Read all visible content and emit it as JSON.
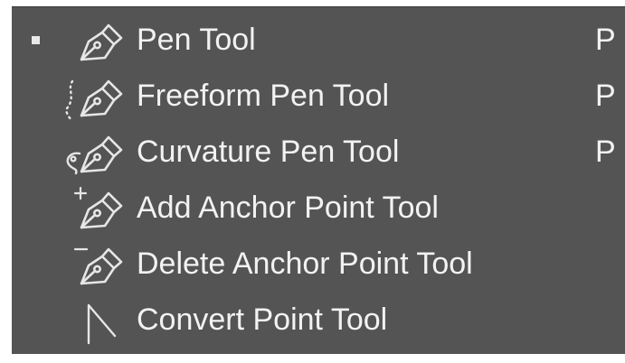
{
  "menu": {
    "items": [
      {
        "label": "Pen Tool",
        "shortcut": "P",
        "icon": "pen-icon",
        "selected": true
      },
      {
        "label": "Freeform Pen Tool",
        "shortcut": "P",
        "icon": "freeform-pen-icon",
        "selected": false
      },
      {
        "label": "Curvature Pen Tool",
        "shortcut": "P",
        "icon": "curvature-pen-icon",
        "selected": false
      },
      {
        "label": "Add Anchor Point Tool",
        "shortcut": "",
        "icon": "add-anchor-point-icon",
        "selected": false
      },
      {
        "label": "Delete Anchor Point Tool",
        "shortcut": "",
        "icon": "delete-anchor-point-icon",
        "selected": false
      },
      {
        "label": "Convert Point Tool",
        "shortcut": "",
        "icon": "convert-point-icon",
        "selected": false
      }
    ]
  },
  "colors": {
    "menu_background": "#545454",
    "text": "#f2f2f2"
  }
}
